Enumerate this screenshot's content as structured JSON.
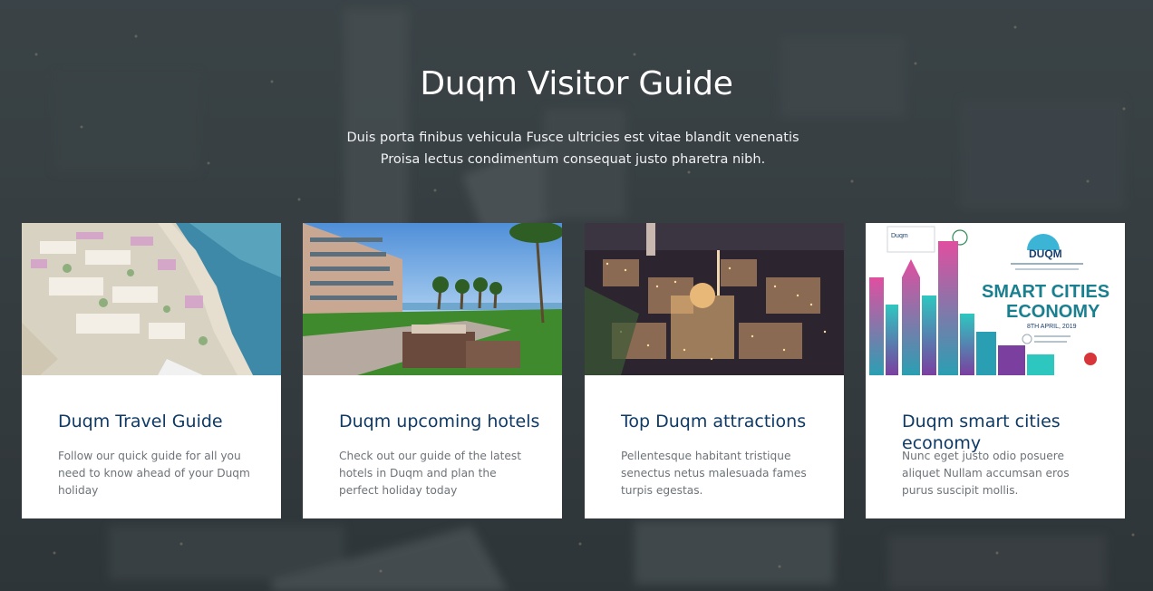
{
  "hero": {
    "title": "Duqm Visitor Guide",
    "subtitle": "Duis porta finibus vehicula Fusce ultricies est vitae blandit venenatis Proisa lectus condimentum consequat justo pharetra nibh."
  },
  "cards": [
    {
      "title": "Duqm Travel Guide",
      "text": "Follow our quick guide for all you need to know ahead of your Duqm holiday",
      "image": "city-masterplan-aerial-image"
    },
    {
      "title": "Duqm upcoming hotels",
      "text": "Check out our guide of the latest hotels in Duqm and plan the perfect holiday today",
      "image": "hotel-garden-palms-image"
    },
    {
      "title": "Top Duqm attractions",
      "text": "Pellentesque habitant tristique senectus netus malesuada fames turpis egestas.",
      "image": "night-city-aerial-image"
    },
    {
      "title": "Duqm smart cities economy",
      "text": "Nunc eget justo odio posuere aliquet Nullam accumsan eros purus suscipit mollis.",
      "image": "smart-cities-poster-image"
    }
  ],
  "poster": {
    "brand": "Duqm",
    "event_title": "DUQM",
    "headline_1": "SMART CITIES",
    "headline_2": "ECONOMY",
    "date": "8TH APRIL, 2019"
  },
  "colors": {
    "title_blue": "#0e3a66",
    "body_grey": "#6d7378",
    "poster_teal": "#1a7f8e"
  }
}
